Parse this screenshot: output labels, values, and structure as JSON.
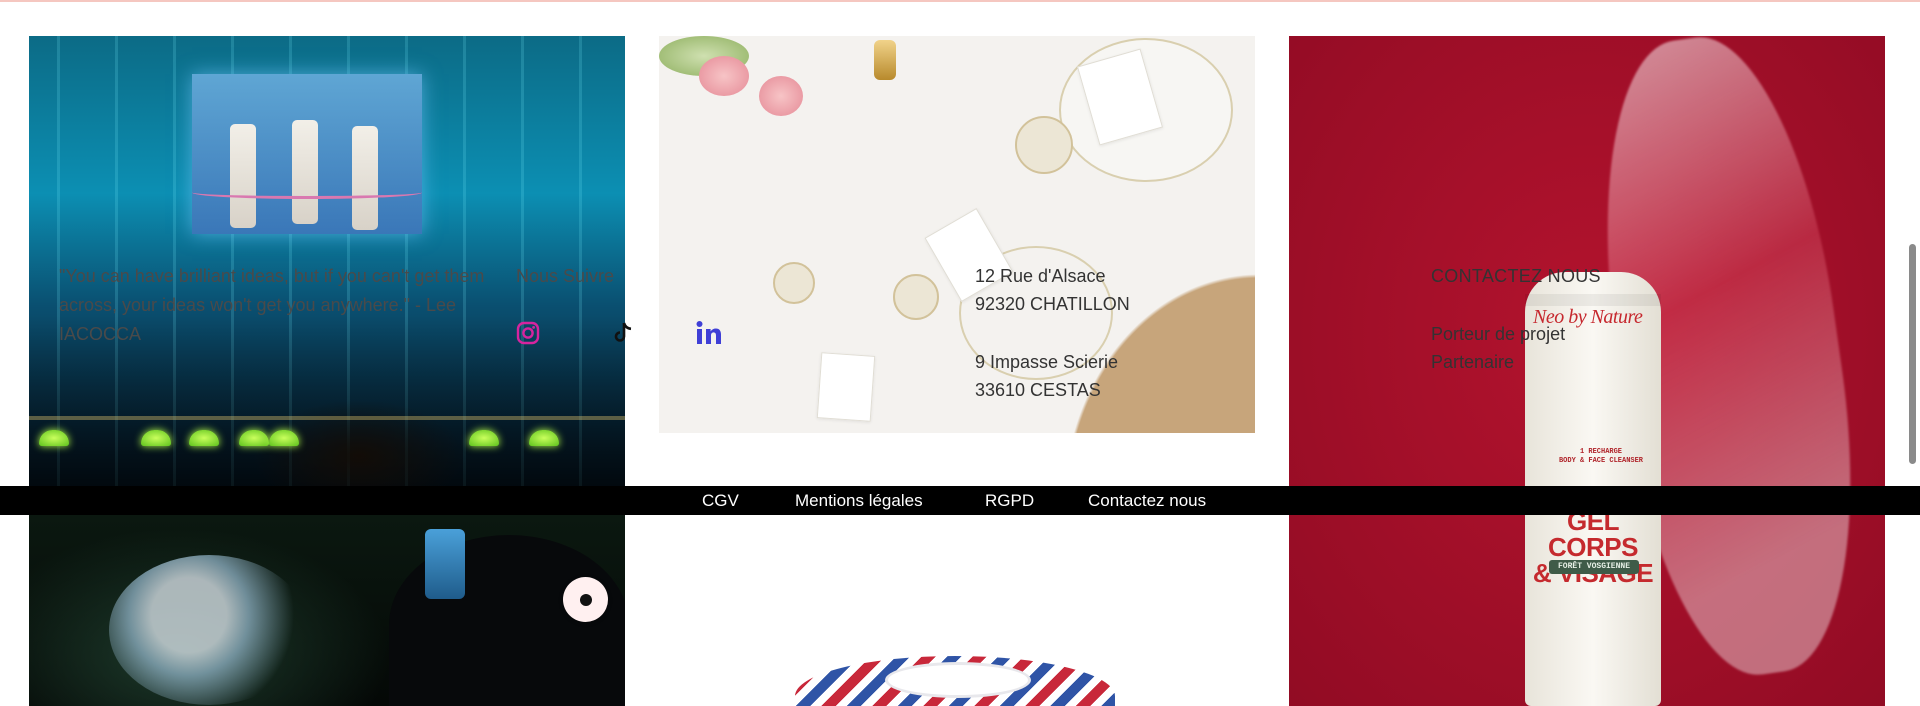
{
  "quote": {
    "text": "\"You can have brilliant ideas, but if you can't get them across, your ideas won't get you anywhere.\" - Lee IACOCCA"
  },
  "follow": {
    "label": "Nous Suivre",
    "icons": [
      "instagram-icon",
      "tiktok-icon",
      "linkedin-icon"
    ],
    "colors": {
      "instagram": "#d6249f",
      "tiktok": "#111111",
      "linkedin": "#3f3fd6"
    }
  },
  "addresses": [
    {
      "line1": "12 Rue d'Alsace",
      "line2": "92320 CHATILLON"
    },
    {
      "line1": "9 Impasse Scierie",
      "line2": "33610 CESTAS"
    }
  ],
  "contact": {
    "heading": "CONTACTEZ NOUS",
    "links": [
      "Porteur de projet",
      "Partenaire"
    ]
  },
  "footer": {
    "links": [
      "CGV",
      "Mentions légales",
      "RGPD",
      "Contactez nous"
    ],
    "background": "#000000"
  },
  "product": {
    "brand": "Neo by Nature",
    "subtitle_line1": "1 RECHARGE",
    "subtitle_line2": "BODY & FACE CLEANSER",
    "title_line1": "GEL CORPS",
    "title_line2": "& VISAGE",
    "tag": "FORÊT VOSGIENNE"
  },
  "accent": {
    "tile3_bg": "#a10f29"
  }
}
